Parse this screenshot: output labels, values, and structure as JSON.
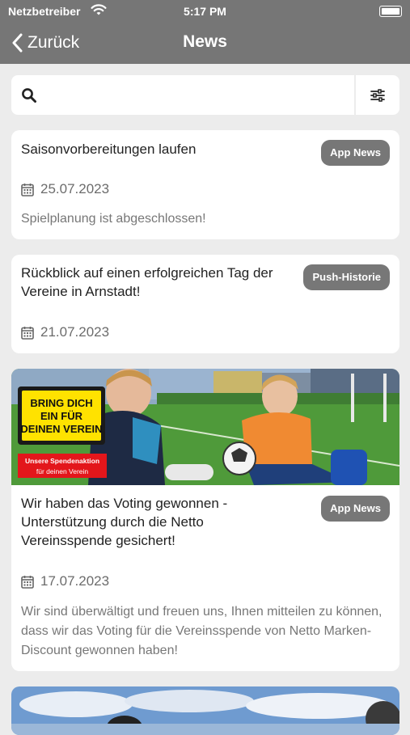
{
  "status_bar": {
    "carrier": "Netzbetreiber",
    "time": "5:17 PM"
  },
  "nav": {
    "back_label": "Zurück",
    "title": "News"
  },
  "search": {
    "placeholder": ""
  },
  "articles": [
    {
      "title": "Saisonvorbereitungen laufen",
      "badge": "App News",
      "date": "25.07.2023",
      "description": "Spielplanung ist abgeschlossen!"
    },
    {
      "title": "Rückblick auf einen erfolgreichen Tag der Vereine in Arnstadt!",
      "badge": "Push-Historie",
      "date": "21.07.2023"
    },
    {
      "title": "Wir haben das Voting gewonnen - Unterstützung durch die Netto Vereinsspende gesichert!",
      "badge": "App News",
      "date": "17.07.2023",
      "description": "Wir sind überwältigt und freuen uns, Ihnen mitteilen zu können, dass wir das Voting für die Vereinsspende von Netto Marken-Discount gewonnen haben!",
      "image": {
        "sign_text": "BRING DICH EIN FÜR DEINEN VEREIN",
        "sign_line1": "BRING DICH",
        "sign_line2": "EIN FÜR",
        "sign_line3": "DEINEN VEREIN",
        "promo_line1": "Unsere Spendenaktion",
        "promo_line2": "für deinen Verein"
      }
    }
  ],
  "colors": {
    "header": "#767676",
    "badge": "#777777",
    "background": "#ececec"
  }
}
